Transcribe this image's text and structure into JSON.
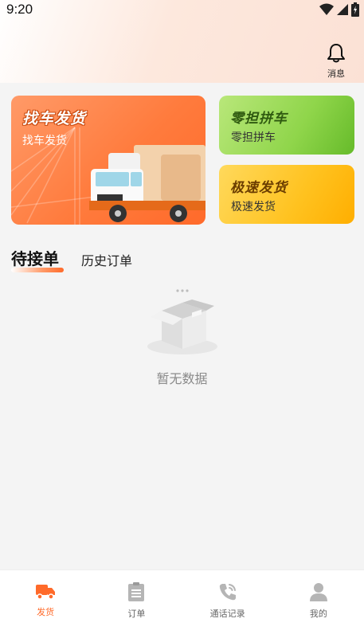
{
  "status_bar": {
    "time": "9:20"
  },
  "header": {
    "message_label": "消息",
    "message_icon": "bell-icon"
  },
  "banner_main": {
    "title": "找车发货",
    "subtitle": "找车发货"
  },
  "card_green": {
    "title": "零担拼车",
    "subtitle": "零担拼车"
  },
  "card_yellow": {
    "title": "极速发货",
    "subtitle": "极速发货"
  },
  "tabs": {
    "active": "待接单",
    "other": "历史订单"
  },
  "empty_state": {
    "text": "暂无数据",
    "icon": "empty-box-icon"
  },
  "bottom_nav": {
    "items": [
      {
        "label": "发货",
        "icon": "truck-icon",
        "active": true
      },
      {
        "label": "订单",
        "icon": "clipboard-icon",
        "active": false
      },
      {
        "label": "通话记录",
        "icon": "phone-icon",
        "active": false
      },
      {
        "label": "我的",
        "icon": "user-icon",
        "active": false
      }
    ]
  },
  "colors": {
    "accent": "#ff6a2a",
    "green_card": "#8fd54a",
    "yellow_card": "#ffc21f",
    "inactive_icon": "#b5b5b5"
  }
}
